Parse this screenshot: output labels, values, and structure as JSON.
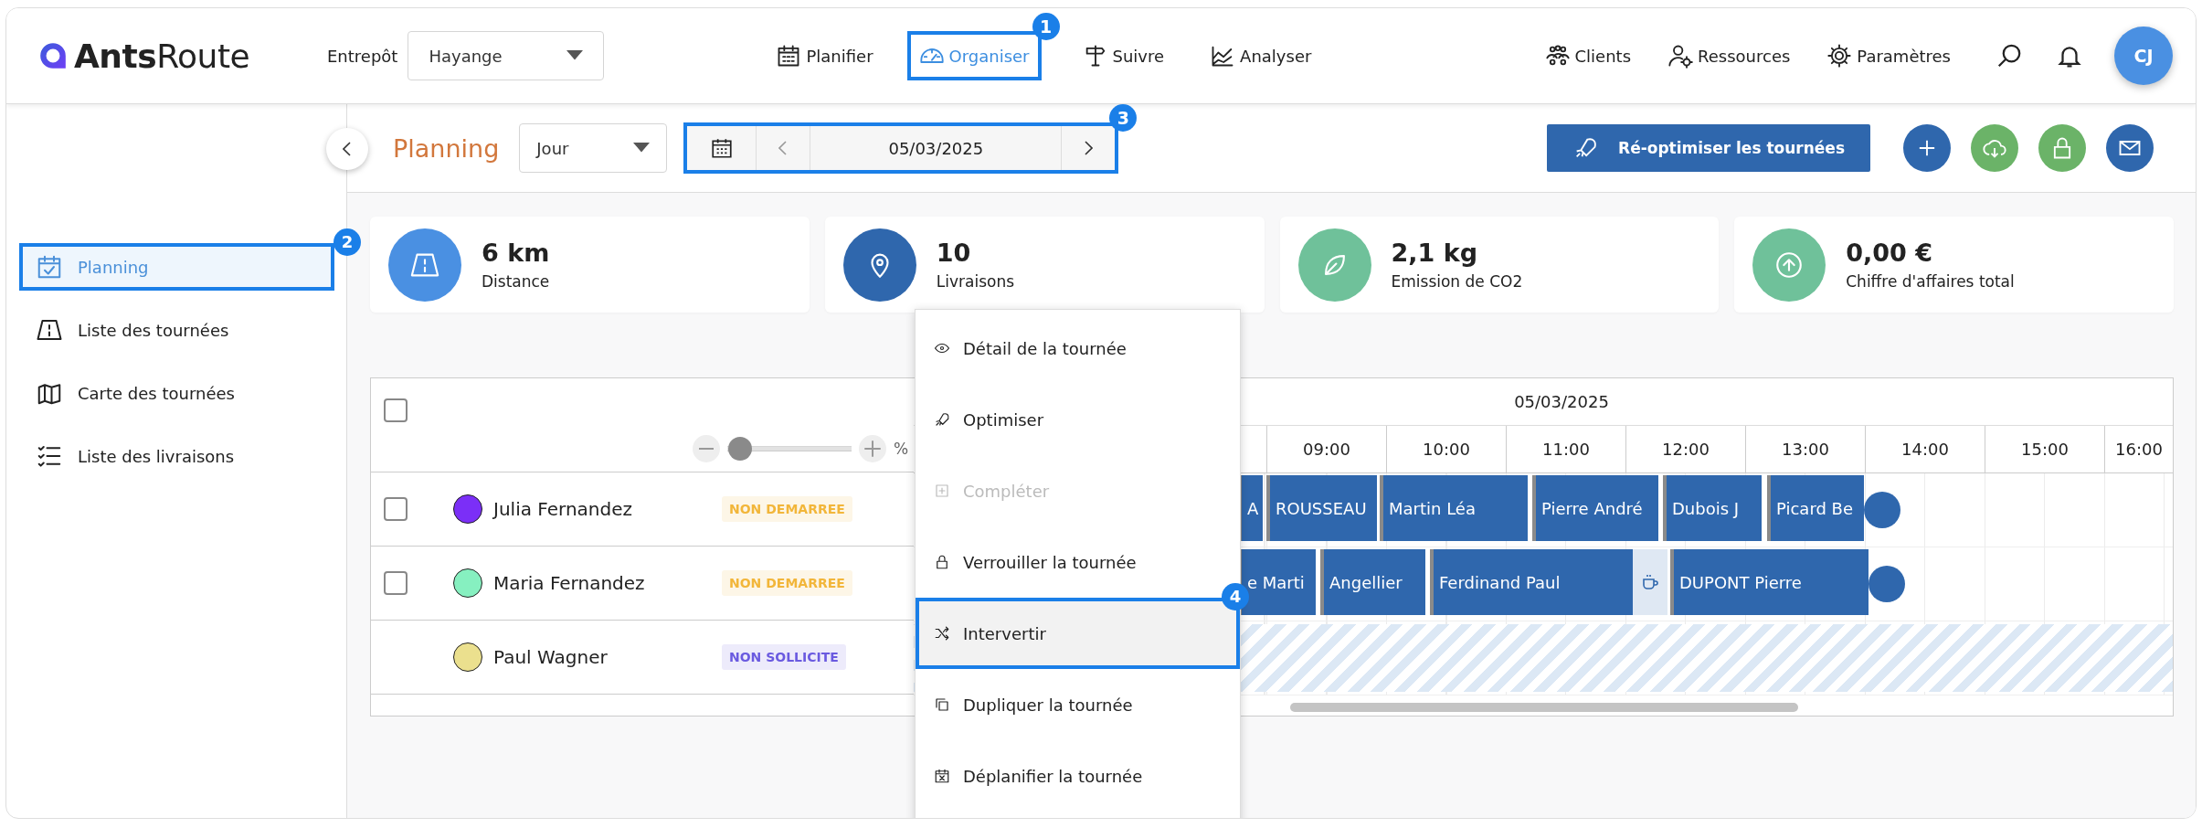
{
  "header": {
    "logo": "**Ants**Route",
    "warehouse": {
      "label": "Entrepôt",
      "value": "Hayange"
    },
    "nav": [
      {
        "label": "Planifier",
        "selected": false
      },
      {
        "label": "Organiser",
        "selected": true,
        "callout": "1"
      },
      {
        "label": "Suivre",
        "selected": false
      },
      {
        "label": "Analyser",
        "selected": false
      }
    ],
    "links": [
      {
        "label": "Clients"
      },
      {
        "label": "Ressources"
      },
      {
        "label": "Paramètres"
      }
    ],
    "avatar": "CJ"
  },
  "sidebar": {
    "items": [
      {
        "label": "Planning",
        "selected": true,
        "callout": "2"
      },
      {
        "label": "Liste des tournées",
        "selected": false
      },
      {
        "label": "Carte des tournées",
        "selected": false
      },
      {
        "label": "Liste des livraisons",
        "selected": false
      }
    ]
  },
  "toolbar": {
    "title": "Planning",
    "view": "Jour",
    "date": "05/03/2025",
    "date_callout": "3",
    "primary_action": "Ré-optimiser les tournées"
  },
  "stats": [
    {
      "value": "6 km",
      "label": "Distance",
      "color": "#4a90e2"
    },
    {
      "value": "10",
      "label": "Livraisons",
      "color": "#2f67ad"
    },
    {
      "value": "2,1 kg",
      "label": "Emission de CO2",
      "color": "#6fc19a"
    },
    {
      "value": "0,00 €",
      "label": "Chiffre d'affaires total",
      "color": "#6fc19a"
    }
  ],
  "table": {
    "select_all_checked": false,
    "zoom": {
      "level": 0.1,
      "unit": "%"
    },
    "date": "05/03/2025",
    "hours": [
      "09:00",
      "10:00",
      "11:00",
      "12:00",
      "13:00",
      "14:00",
      "15:00",
      "16:00"
    ],
    "rows": [
      {
        "name": "Julia Fernandez",
        "color": "#7b2ff7",
        "status": {
          "label": "NON DEMARREE",
          "color": "#f2b63a"
        },
        "selectable": true,
        "checked": false,
        "unavailable": false,
        "end_marker": true,
        "bars": [
          {
            "kind": "stop",
            "label": "A"
          },
          {
            "kind": "stop",
            "label": "ROUSSEAU"
          },
          {
            "kind": "stop",
            "label": "Martin Léa"
          },
          {
            "kind": "stop",
            "label": "Pierre André"
          },
          {
            "kind": "stop",
            "label": "Dubois J"
          },
          {
            "kind": "stop",
            "label": "Picard Be"
          }
        ]
      },
      {
        "name": "Maria Fernandez",
        "color": "#86f0c0",
        "status": {
          "label": "NON DEMARREE",
          "color": "#f2b63a"
        },
        "selectable": true,
        "checked": false,
        "unavailable": false,
        "end_marker": true,
        "bars": [
          {
            "kind": "stop",
            "label": "e Marti"
          },
          {
            "kind": "stop",
            "label": "Angellier"
          },
          {
            "kind": "stop",
            "label": "Ferdinand Paul"
          },
          {
            "kind": "break"
          },
          {
            "kind": "stop",
            "label": "DUPONT Pierre"
          }
        ]
      },
      {
        "name": "Paul Wagner",
        "color": "#ebe08e",
        "status": {
          "label": "NON SOLLICITE",
          "color": "#6a5ae0"
        },
        "selectable": false,
        "unavailable": true,
        "end_marker": false
      }
    ]
  },
  "context_menu": {
    "items": [
      {
        "label": "Détail de la tournée",
        "disabled": false,
        "selected": false
      },
      {
        "label": "Optimiser",
        "disabled": false,
        "selected": false
      },
      {
        "label": "Compléter",
        "disabled": true,
        "selected": false
      },
      {
        "label": "Verrouiller la tournée",
        "disabled": false,
        "selected": false
      },
      {
        "label": "Intervertir",
        "disabled": false,
        "selected": true,
        "callout": "4"
      },
      {
        "label": "Dupliquer la tournée",
        "disabled": false,
        "selected": false
      },
      {
        "label": "Déplanifier la tournée",
        "disabled": false,
        "selected": false
      }
    ]
  }
}
